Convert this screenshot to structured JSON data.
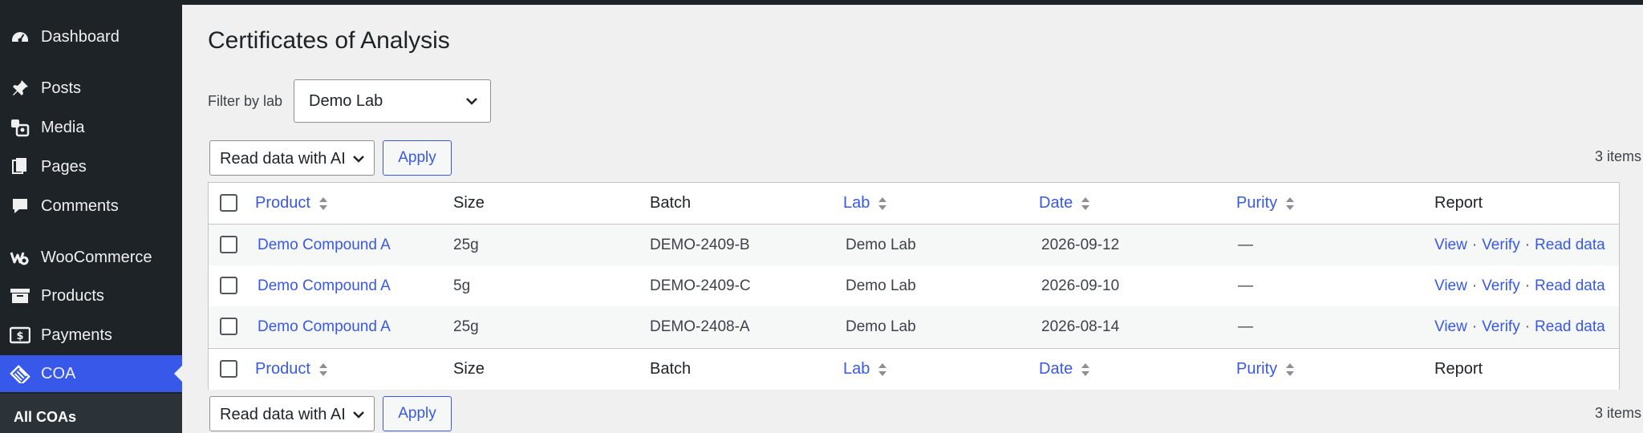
{
  "sidebar": {
    "items": [
      {
        "label": "Dashboard",
        "icon": "dashboard-icon"
      },
      {
        "label": "Posts",
        "icon": "pin-icon"
      },
      {
        "label": "Media",
        "icon": "media-icon"
      },
      {
        "label": "Pages",
        "icon": "pages-icon"
      },
      {
        "label": "Comments",
        "icon": "comment-icon"
      },
      {
        "label": "WooCommerce",
        "icon": "woocommerce-icon"
      },
      {
        "label": "Products",
        "icon": "archive-icon"
      },
      {
        "label": "Payments",
        "icon": "payments-icon"
      },
      {
        "label": "COA",
        "icon": "coa-icon"
      }
    ],
    "submenu": {
      "label": "All COAs"
    }
  },
  "page": {
    "title": "Certificates of Analysis",
    "filter_label": "Filter by lab",
    "filter_value": "Demo Lab"
  },
  "bulk": {
    "top_value": "Read data with AI",
    "bottom_value": "Read data with AI",
    "apply_label": "Apply"
  },
  "count_label": "3 items",
  "table": {
    "columns": [
      "Product",
      "Size",
      "Batch",
      "Lab",
      "Date",
      "Purity",
      "Report"
    ],
    "rows": [
      {
        "product": "Demo Compound A",
        "size": "25g",
        "batch": "DEMO-2409-B",
        "lab": "Demo Lab",
        "date": "2026-09-12",
        "purity": "—"
      },
      {
        "product": "Demo Compound A",
        "size": "5g",
        "batch": "DEMO-2409-C",
        "lab": "Demo Lab",
        "date": "2026-09-10",
        "purity": "—"
      },
      {
        "product": "Demo Compound A",
        "size": "25g",
        "batch": "DEMO-2408-A",
        "lab": "Demo Lab",
        "date": "2026-08-14",
        "purity": "—"
      }
    ],
    "report_links": {
      "view": "View",
      "verify": "Verify",
      "read": "Read data",
      "separator": "·"
    }
  },
  "colors": {
    "accent": "#3858e9",
    "sidebar_bg": "#1d2327",
    "page_bg": "#f0f0f1"
  }
}
